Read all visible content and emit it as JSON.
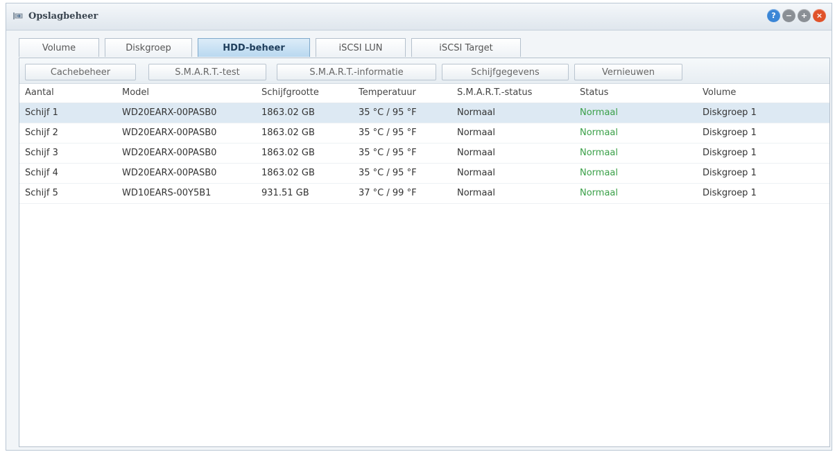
{
  "window": {
    "title": "Opslagbeheer",
    "icon": "storage-icon"
  },
  "title_buttons": [
    {
      "name": "help-button",
      "icon": "help-icon",
      "glyph": "?",
      "color": "#3b86d6"
    },
    {
      "name": "minimize-button",
      "icon": "minimize-icon",
      "glyph": "−",
      "color": "#8a8f95"
    },
    {
      "name": "maximize-button",
      "icon": "maximize-icon",
      "glyph": "+",
      "color": "#8a8f95"
    },
    {
      "name": "close-button",
      "icon": "close-icon",
      "glyph": "×",
      "color": "#e0522a"
    }
  ],
  "tabs": [
    {
      "label": "Volume",
      "active": false
    },
    {
      "label": "Diskgroep",
      "active": false
    },
    {
      "label": "HDD-beheer",
      "active": true
    },
    {
      "label": "iSCSI LUN",
      "active": false
    },
    {
      "label": "iSCSI Target",
      "active": false
    }
  ],
  "toolbar": {
    "cache_label": "Cachebeheer",
    "smart_test_label": "S.M.A.R.T.-test",
    "smart_info_label": "S.M.A.R.T.-informatie",
    "disk_info_label": "Schijfgegevens",
    "refresh_label": "Vernieuwen"
  },
  "table": {
    "columns": [
      "Aantal",
      "Model",
      "Schijfgrootte",
      "Temperatuur",
      "S.M.A.R.T.-status",
      "Status",
      "Volume"
    ],
    "rows": [
      [
        "Schijf 1",
        "WD20EARX-00PASB0",
        "1863.02 GB",
        "35 °C / 95 °F",
        "Normaal",
        "Normaal",
        "Diskgroep 1"
      ],
      [
        "Schijf 2",
        "WD20EARX-00PASB0",
        "1863.02 GB",
        "35 °C / 95 °F",
        "Normaal",
        "Normaal",
        "Diskgroep 1"
      ],
      [
        "Schijf 3",
        "WD20EARX-00PASB0",
        "1863.02 GB",
        "35 °C / 95 °F",
        "Normaal",
        "Normaal",
        "Diskgroep 1"
      ],
      [
        "Schijf 4",
        "WD20EARX-00PASB0",
        "1863.02 GB",
        "35 °C / 95 °F",
        "Normaal",
        "Normaal",
        "Diskgroep 1"
      ],
      [
        "Schijf 5",
        "WD10EARS-00Y5B1",
        "931.51 GB",
        "37 °C / 99 °F",
        "Normaal",
        "Normaal",
        "Diskgroep 1"
      ]
    ],
    "selected_row": 0
  },
  "colors": {
    "status_ok": "#3aa048",
    "selected_row": "#dde9f3"
  }
}
